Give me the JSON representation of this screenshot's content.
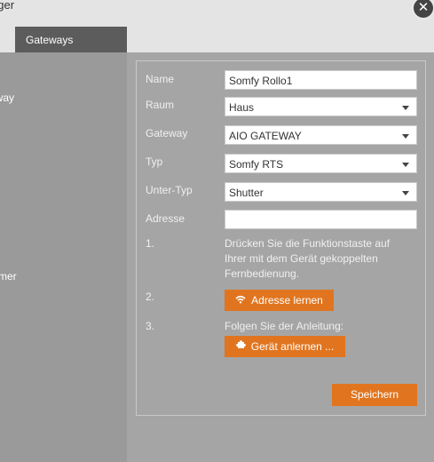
{
  "window": {
    "title_fragment": "ager",
    "close_glyph": "✕"
  },
  "tabs": [
    {
      "label": "Gateways"
    }
  ],
  "sidebar": {
    "items": [
      {
        "label": "eway"
      },
      {
        "label": "mmer"
      }
    ]
  },
  "form": {
    "name_label": "Name",
    "name_value": "Somfy Rollo1",
    "raum_label": "Raum",
    "raum_value": "Haus",
    "gateway_label": "Gateway",
    "gateway_value": "AIO GATEWAY",
    "typ_label": "Typ",
    "typ_value": "Somfy RTS",
    "untertyp_label": "Unter-Typ",
    "untertyp_value": "Shutter",
    "adresse_label": "Adresse",
    "adresse_value": ""
  },
  "steps": [
    {
      "num": "1.",
      "line1": "Drücken Sie die Funktionstaste auf",
      "line2": "Ihrer mit dem Gerät gekoppelten",
      "line3": "Fernbedienung."
    },
    {
      "num": "2.",
      "button": "Adresse lernen",
      "icon": "wifi-icon"
    },
    {
      "num": "3.",
      "text": "Folgen Sie der Anleitung:",
      "button": "Gerät anlernen ...",
      "icon": "puzzle-icon"
    }
  ],
  "save_label": "Speichern",
  "colors": {
    "accent": "#e1751f",
    "tab_active": "#5c5c5c"
  }
}
